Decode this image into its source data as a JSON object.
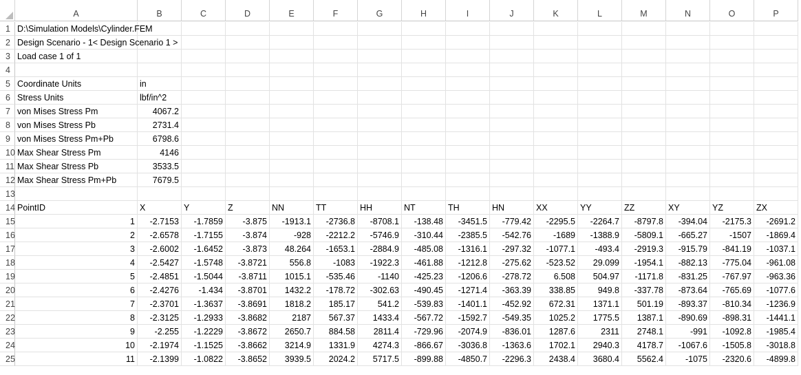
{
  "columns": [
    "A",
    "B",
    "C",
    "D",
    "E",
    "F",
    "G",
    "H",
    "I",
    "J",
    "K",
    "L",
    "M",
    "N",
    "O",
    "P"
  ],
  "rows": [
    {
      "n": "1",
      "cells": [
        "D:\\Simulation Models\\Cylinder.FEM",
        "",
        "",
        "",
        "",
        "",
        "",
        "",
        "",
        "",
        "",
        "",
        "",
        "",
        "",
        ""
      ]
    },
    {
      "n": "2",
      "cells": [
        "Design Scenario - 1< Design Scenario 1 >",
        "",
        "",
        "",
        "",
        "",
        "",
        "",
        "",
        "",
        "",
        "",
        "",
        "",
        "",
        ""
      ]
    },
    {
      "n": "3",
      "cells": [
        "Load case 1 of 1",
        "",
        "",
        "",
        "",
        "",
        "",
        "",
        "",
        "",
        "",
        "",
        "",
        "",
        "",
        ""
      ]
    },
    {
      "n": "4",
      "cells": [
        "",
        "",
        "",
        "",
        "",
        "",
        "",
        "",
        "",
        "",
        "",
        "",
        "",
        "",
        "",
        ""
      ]
    },
    {
      "n": "5",
      "cells": [
        "Coordinate Units",
        "in",
        "",
        "",
        "",
        "",
        "",
        "",
        "",
        "",
        "",
        "",
        "",
        "",
        "",
        ""
      ]
    },
    {
      "n": "6",
      "cells": [
        "Stress Units",
        "lbf/in^2",
        "",
        "",
        "",
        "",
        "",
        "",
        "",
        "",
        "",
        "",
        "",
        "",
        "",
        ""
      ]
    },
    {
      "n": "7",
      "cells": [
        "von Mises Stress Pm",
        "4067.2",
        "",
        "",
        "",
        "",
        "",
        "",
        "",
        "",
        "",
        "",
        "",
        "",
        "",
        ""
      ]
    },
    {
      "n": "8",
      "cells": [
        "von Mises Stress Pb",
        "2731.4",
        "",
        "",
        "",
        "",
        "",
        "",
        "",
        "",
        "",
        "",
        "",
        "",
        "",
        ""
      ]
    },
    {
      "n": "9",
      "cells": [
        "von Mises Stress Pm+Pb",
        "6798.6",
        "",
        "",
        "",
        "",
        "",
        "",
        "",
        "",
        "",
        "",
        "",
        "",
        "",
        ""
      ]
    },
    {
      "n": "10",
      "cells": [
        "Max Shear Stress Pm",
        "4146",
        "",
        "",
        "",
        "",
        "",
        "",
        "",
        "",
        "",
        "",
        "",
        "",
        "",
        ""
      ]
    },
    {
      "n": "11",
      "cells": [
        "Max Shear Stress Pb",
        "3533.5",
        "",
        "",
        "",
        "",
        "",
        "",
        "",
        "",
        "",
        "",
        "",
        "",
        "",
        ""
      ]
    },
    {
      "n": "12",
      "cells": [
        "Max Shear Stress Pm+Pb",
        "7679.5",
        "",
        "",
        "",
        "",
        "",
        "",
        "",
        "",
        "",
        "",
        "",
        "",
        "",
        ""
      ]
    },
    {
      "n": "13",
      "cells": [
        "",
        "",
        "",
        "",
        "",
        "",
        "",
        "",
        "",
        "",
        "",
        "",
        "",
        "",
        "",
        ""
      ]
    },
    {
      "n": "14",
      "cells": [
        "PointID",
        "X",
        "Y",
        "Z",
        "NN",
        "TT",
        "HH",
        "NT",
        "TH",
        "HN",
        "XX",
        "YY",
        "ZZ",
        "XY",
        "YZ",
        "ZX"
      ]
    },
    {
      "n": "15",
      "cells": [
        "1",
        "-2.7153",
        "-1.7859",
        "-3.875",
        "-1913.1",
        "-2736.8",
        "-8708.1",
        "-138.48",
        "-3451.5",
        "-779.42",
        "-2295.5",
        "-2264.7",
        "-8797.8",
        "-394.04",
        "-2175.3",
        "-2691.2"
      ]
    },
    {
      "n": "16",
      "cells": [
        "2",
        "-2.6578",
        "-1.7155",
        "-3.874",
        "-928",
        "-2212.2",
        "-5746.9",
        "-310.44",
        "-2385.5",
        "-542.76",
        "-1689",
        "-1388.9",
        "-5809.1",
        "-665.27",
        "-1507",
        "-1869.4"
      ]
    },
    {
      "n": "17",
      "cells": [
        "3",
        "-2.6002",
        "-1.6452",
        "-3.873",
        "48.264",
        "-1653.1",
        "-2884.9",
        "-485.08",
        "-1316.1",
        "-297.32",
        "-1077.1",
        "-493.4",
        "-2919.3",
        "-915.79",
        "-841.19",
        "-1037.1"
      ]
    },
    {
      "n": "18",
      "cells": [
        "4",
        "-2.5427",
        "-1.5748",
        "-3.8721",
        "556.8",
        "-1083",
        "-1922.3",
        "-461.88",
        "-1212.8",
        "-275.62",
        "-523.52",
        "29.099",
        "-1954.1",
        "-882.13",
        "-775.04",
        "-961.08"
      ]
    },
    {
      "n": "19",
      "cells": [
        "5",
        "-2.4851",
        "-1.5044",
        "-3.8711",
        "1015.1",
        "-535.46",
        "-1140",
        "-425.23",
        "-1206.6",
        "-278.72",
        "6.508",
        "504.97",
        "-1171.8",
        "-831.25",
        "-767.97",
        "-963.36"
      ]
    },
    {
      "n": "20",
      "cells": [
        "6",
        "-2.4276",
        "-1.434",
        "-3.8701",
        "1432.2",
        "-178.72",
        "-302.63",
        "-490.45",
        "-1271.4",
        "-363.39",
        "338.85",
        "949.8",
        "-337.78",
        "-873.64",
        "-765.69",
        "-1077.6"
      ]
    },
    {
      "n": "21",
      "cells": [
        "7",
        "-2.3701",
        "-1.3637",
        "-3.8691",
        "1818.2",
        "185.17",
        "541.2",
        "-539.83",
        "-1401.1",
        "-452.92",
        "672.31",
        "1371.1",
        "501.19",
        "-893.37",
        "-810.34",
        "-1236.9"
      ]
    },
    {
      "n": "22",
      "cells": [
        "8",
        "-2.3125",
        "-1.2933",
        "-3.8682",
        "2187",
        "567.37",
        "1433.4",
        "-567.72",
        "-1592.7",
        "-549.35",
        "1025.2",
        "1775.5",
        "1387.1",
        "-890.69",
        "-898.31",
        "-1441.1"
      ]
    },
    {
      "n": "23",
      "cells": [
        "9",
        "-2.255",
        "-1.2229",
        "-3.8672",
        "2650.7",
        "884.58",
        "2811.4",
        "-729.96",
        "-2074.9",
        "-836.01",
        "1287.6",
        "2311",
        "2748.1",
        "-991",
        "-1092.8",
        "-1985.4"
      ]
    },
    {
      "n": "24",
      "cells": [
        "10",
        "-2.1974",
        "-1.1525",
        "-3.8662",
        "3214.9",
        "1331.9",
        "4274.3",
        "-866.67",
        "-3036.8",
        "-1363.6",
        "1702.1",
        "2940.3",
        "4178.7",
        "-1067.6",
        "-1505.8",
        "-3018.8"
      ]
    },
    {
      "n": "25",
      "cells": [
        "11",
        "-2.1399",
        "-1.0822",
        "-3.8652",
        "3939.5",
        "2024.2",
        "5717.5",
        "-899.88",
        "-4850.7",
        "-2296.3",
        "2438.4",
        "3680.4",
        "5562.4",
        "-1075",
        "-2320.6",
        "-4899.8"
      ]
    }
  ]
}
